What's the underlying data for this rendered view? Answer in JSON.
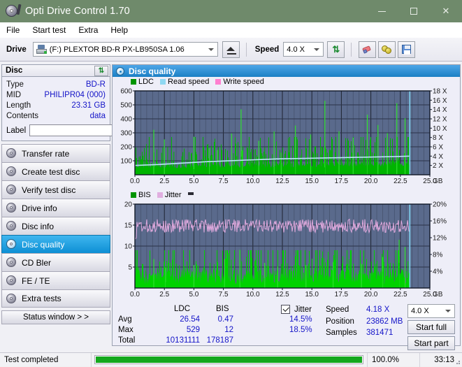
{
  "window": {
    "title": "Opti Drive Control 1.70",
    "icon": "disc-pen-icon",
    "titlebar_color": "#6f8a6b",
    "minimize": "—",
    "maximize": "□",
    "close": "✕"
  },
  "menu": {
    "items": [
      "File",
      "Start test",
      "Extra",
      "Help"
    ]
  },
  "toolbar": {
    "drive_label": "Drive",
    "drive_value": "(F:)  PLEXTOR BD-R  PX-LB950SA 1.06",
    "eject_title": "Eject",
    "speed_label": "Speed",
    "speed_value": "4.0 X",
    "refresh_title": "Refresh",
    "erase_title": "Erase",
    "coins_title": "Bitsetting",
    "save_title": "Save"
  },
  "disc": {
    "header": "Disc",
    "refresh_icon": "refresh-icon",
    "rows": [
      {
        "key": "Type",
        "value": "BD-R"
      },
      {
        "key": "MID",
        "value": "PHILIPR04 (000)"
      },
      {
        "key": "Length",
        "value": "23.31 GB"
      },
      {
        "key": "Contents",
        "value": "data"
      }
    ],
    "label_key": "Label",
    "label_value": "",
    "label_placeholder": ""
  },
  "nav": {
    "items": [
      {
        "label": "Transfer rate",
        "active": false
      },
      {
        "label": "Create test disc",
        "active": false
      },
      {
        "label": "Verify test disc",
        "active": false
      },
      {
        "label": "Drive info",
        "active": false
      },
      {
        "label": "Disc info",
        "active": false
      },
      {
        "label": "Disc quality",
        "active": true
      },
      {
        "label": "CD Bler",
        "active": false
      },
      {
        "label": "FE / TE",
        "active": false
      },
      {
        "label": "Extra tests",
        "active": false
      }
    ],
    "status_window": "Status window > >"
  },
  "main": {
    "title": "Disc quality",
    "title_icon": "disc-quality-icon"
  },
  "chart_data": [
    {
      "type": "area",
      "title": "LDC / Read speed",
      "legend": [
        {
          "label": "LDC",
          "color": "#009400"
        },
        {
          "label": "Read speed",
          "color": "#8fd8f2"
        },
        {
          "label": "Write speed",
          "color": "#ff7fd0"
        }
      ],
      "legend_position": "top-left",
      "grid": true,
      "plot_bg": "#5a6a8c",
      "xlabel": "GB",
      "xlim": [
        0,
        25
      ],
      "xticks": [
        "0.0",
        "2.5",
        "5.0",
        "7.5",
        "10.0",
        "12.5",
        "15.0",
        "17.5",
        "20.0",
        "22.5",
        "25.0"
      ],
      "ylabel": "LDC",
      "ylim": [
        0,
        600
      ],
      "yticks": [
        100,
        200,
        300,
        400,
        500,
        600
      ],
      "y2label": "Speed",
      "y2lim": [
        0,
        18
      ],
      "y2ticks": [
        "2 X",
        "4 X",
        "6 X",
        "8 X",
        "10 X",
        "12 X",
        "14 X",
        "16 X",
        "18 X"
      ],
      "data_end_gb": 23.3,
      "series": [
        {
          "name": "LDC",
          "type": "area",
          "color": "#00b400",
          "baseline_values": [
            55,
            60,
            58,
            62,
            60,
            64,
            62,
            66,
            68,
            66,
            70,
            68,
            72,
            70,
            74,
            72,
            76,
            78,
            76,
            80,
            78,
            82,
            84,
            86
          ],
          "peak_samples": [
            {
              "x": 1.6,
              "y": 322
            },
            {
              "x": 2.5,
              "y": 253
            },
            {
              "x": 5.0,
              "y": 272
            },
            {
              "x": 6.3,
              "y": 190
            },
            {
              "x": 7.0,
              "y": 177
            },
            {
              "x": 8.2,
              "y": 295
            },
            {
              "x": 9.0,
              "y": 468
            },
            {
              "x": 9.1,
              "y": 175
            },
            {
              "x": 10.5,
              "y": 243
            },
            {
              "x": 11.8,
              "y": 310
            },
            {
              "x": 12.4,
              "y": 158
            },
            {
              "x": 13.6,
              "y": 352
            },
            {
              "x": 14.9,
              "y": 288
            },
            {
              "x": 16.1,
              "y": 529
            },
            {
              "x": 17.3,
              "y": 311
            },
            {
              "x": 18.5,
              "y": 265
            },
            {
              "x": 19.7,
              "y": 430
            },
            {
              "x": 20.6,
              "y": 356
            },
            {
              "x": 21.4,
              "y": 298
            },
            {
              "x": 22.2,
              "y": 512
            },
            {
              "x": 22.9,
              "y": 404
            }
          ]
        },
        {
          "name": "Read speed",
          "type": "line",
          "color": "#b9e6f7",
          "points": [
            {
              "x": 0.0,
              "y": 2.0
            },
            {
              "x": 2.0,
              "y": 2.2
            },
            {
              "x": 4.0,
              "y": 2.5
            },
            {
              "x": 6.0,
              "y": 2.8
            },
            {
              "x": 8.0,
              "y": 3.0
            },
            {
              "x": 10.0,
              "y": 3.2
            },
            {
              "x": 12.0,
              "y": 3.4
            },
            {
              "x": 14.0,
              "y": 3.5
            },
            {
              "x": 16.0,
              "y": 3.6
            },
            {
              "x": 18.0,
              "y": 3.7
            },
            {
              "x": 20.0,
              "y": 3.8
            },
            {
              "x": 22.0,
              "y": 3.9
            },
            {
              "x": 23.3,
              "y": 4.0
            }
          ]
        },
        {
          "name": "Write speed",
          "type": "line",
          "color": "#ff7fd0",
          "points": []
        }
      ]
    },
    {
      "type": "area",
      "title": "BIS / Jitter",
      "legend": [
        {
          "label": "BIS",
          "color": "#009400"
        },
        {
          "label": "Jitter",
          "color": "#e0aee0"
        }
      ],
      "legend_position": "top-left",
      "grid": true,
      "plot_bg": "#5a6a8c",
      "xlabel": "GB",
      "xlim": [
        0,
        25
      ],
      "xticks": [
        "0.0",
        "2.5",
        "5.0",
        "7.5",
        "10.0",
        "12.5",
        "15.0",
        "17.5",
        "20.0",
        "22.5",
        "25.0"
      ],
      "ylabel": "BIS",
      "ylim": [
        0,
        20
      ],
      "yticks": [
        5,
        10,
        15,
        20
      ],
      "y2label": "Jitter",
      "y2lim": [
        0,
        20
      ],
      "y2ticks": [
        "4%",
        "8%",
        "12%",
        "16%",
        "20%"
      ],
      "data_end_gb": 23.3,
      "series": [
        {
          "name": "BIS",
          "type": "area",
          "color": "#00d200",
          "baseline_avg": 2.6,
          "peak_samples": [
            {
              "x": 1.6,
              "y": 6.9
            },
            {
              "x": 2.6,
              "y": 4.9
            },
            {
              "x": 5.0,
              "y": 5.4
            },
            {
              "x": 7.6,
              "y": 6.9
            },
            {
              "x": 8.9,
              "y": 9.1
            },
            {
              "x": 11.0,
              "y": 6.0
            },
            {
              "x": 12.1,
              "y": 5.1
            },
            {
              "x": 14.5,
              "y": 5.5
            },
            {
              "x": 16.8,
              "y": 6.2
            },
            {
              "x": 19.2,
              "y": 5.8
            },
            {
              "x": 21.0,
              "y": 7.4
            },
            {
              "x": 22.4,
              "y": 11.5
            },
            {
              "x": 22.9,
              "y": 9.8
            }
          ]
        },
        {
          "name": "Jitter",
          "type": "line",
          "color": "#dfa9dd",
          "mean": 14.8,
          "min": 11.5,
          "max": 18.0
        }
      ]
    }
  ],
  "stats": {
    "col_headers": [
      "LDC",
      "BIS"
    ],
    "rows": [
      {
        "label": "Avg",
        "ldc": "26.54",
        "bis": "0.47"
      },
      {
        "label": "Max",
        "ldc": "529",
        "bis": "12"
      },
      {
        "label": "Total",
        "ldc": "10131111",
        "bis": "178187"
      }
    ],
    "jitter_checked": true,
    "jitter_label": "Jitter",
    "jitter_avg": "14.5%",
    "jitter_max": "18.5%",
    "speed_label": "Speed",
    "speed_value": "4.18 X",
    "position_label": "Position",
    "position_value": "23862 MB",
    "samples_label": "Samples",
    "samples_value": "381471",
    "speed_select": "4.0 X",
    "start_full": "Start full",
    "start_part": "Start part"
  },
  "statusbar": {
    "message": "Test completed",
    "progress_percent": "100.0%",
    "progress_value": 100,
    "elapsed": "33:13",
    "progress_color": "#14a81e"
  }
}
